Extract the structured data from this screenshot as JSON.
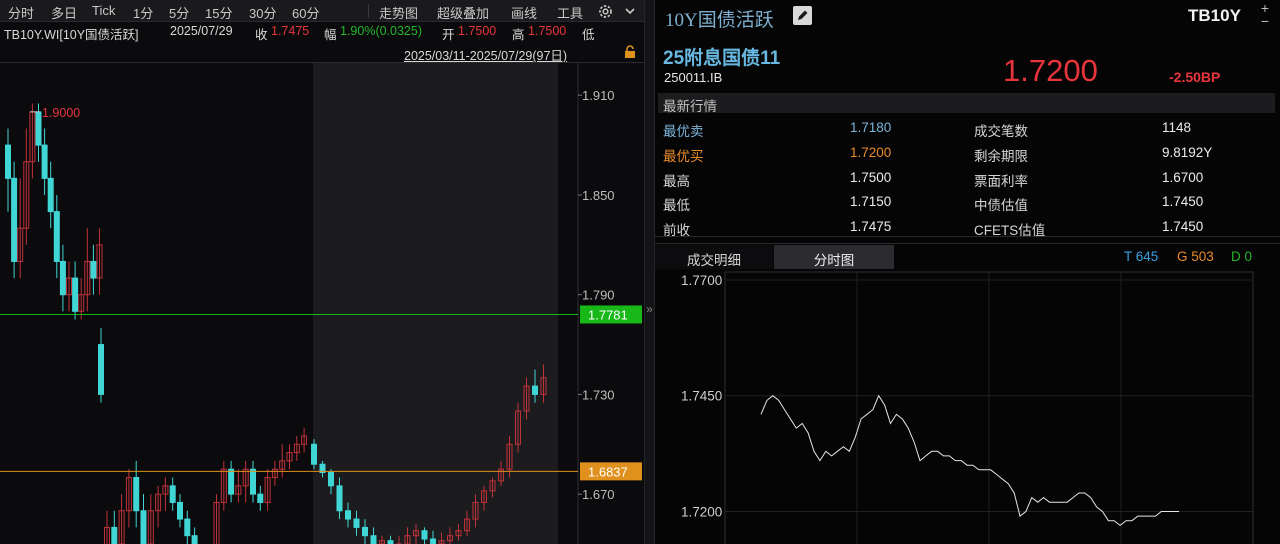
{
  "toolbar": {
    "left_items": [
      "分时",
      "多日",
      "Tick",
      "1分",
      "5分",
      "15分",
      "30分",
      "60分"
    ],
    "right_items": [
      "走势图",
      "超级叠加",
      "画线",
      "工具"
    ],
    "gear_icon": "gear-icon",
    "chevron_icon": "chevron-down-icon"
  },
  "info": {
    "code": "TB10Y.WI[10Y国债活跃]",
    "date": "2025/07/29",
    "close_label": "收",
    "close_value": "1.7475",
    "change_label": "幅",
    "change_value": "1.90%(0.0325)",
    "open_label": "开",
    "open_value": "1.7500",
    "high_label": "高",
    "high_value": "1.7500",
    "low_label": "低",
    "range": "2025/03/11-2025/07/29(97日)",
    "lock_icon": "lock-icon"
  },
  "kline": {
    "max_label": "1.9000",
    "y_ticks": [
      "1.910",
      "1.850",
      "1.790",
      "1.730",
      "1.670"
    ],
    "y_values": [
      1.91,
      1.85,
      1.79,
      1.73,
      1.67
    ],
    "green_line_label": "1.7781",
    "green_line_value": 1.7781,
    "orange_line_label": "1.6837",
    "orange_line_value": 1.6837,
    "up_color": "#c0323a",
    "down_color": "#40d6d6",
    "green_color": "#17b817",
    "orange_color": "#e0901c"
  },
  "chart_data": [
    {
      "type": "candlestick",
      "title": "TB10Y.WI[10Y国债活跃]",
      "ylim": [
        1.64,
        1.93
      ],
      "y_ticks": [
        1.91,
        1.85,
        1.79,
        1.73,
        1.67
      ],
      "series": [
        {
          "name": "K",
          "values": [
            [
              1.88,
              1.86,
              1.89,
              1.84
            ],
            [
              1.86,
              1.81,
              1.87,
              1.8
            ],
            [
              1.81,
              1.83,
              1.86,
              1.8
            ],
            [
              1.83,
              1.87,
              1.89,
              1.82
            ],
            [
              1.87,
              1.9,
              1.905,
              1.86
            ],
            [
              1.9,
              1.88,
              1.905,
              1.87
            ],
            [
              1.88,
              1.86,
              1.89,
              1.85
            ],
            [
              1.86,
              1.84,
              1.87,
              1.83
            ],
            [
              1.84,
              1.81,
              1.85,
              1.8
            ],
            [
              1.81,
              1.79,
              1.82,
              1.78
            ],
            [
              1.79,
              1.8,
              1.81,
              1.78
            ],
            [
              1.8,
              1.78,
              1.81,
              1.775
            ],
            [
              1.78,
              1.79,
              1.8,
              1.775
            ],
            [
              1.79,
              1.81,
              1.83,
              1.78
            ],
            [
              1.81,
              1.8,
              1.82,
              1.79
            ],
            [
              1.8,
              1.82,
              1.83,
              1.79
            ],
            [
              1.76,
              1.73,
              1.77,
              1.725
            ],
            [
              1.63,
              1.65,
              1.66,
              1.62
            ],
            [
              1.65,
              1.64,
              1.66,
              1.63
            ],
            [
              1.64,
              1.66,
              1.67,
              1.63
            ],
            [
              1.66,
              1.68,
              1.685,
              1.65
            ],
            [
              1.68,
              1.66,
              1.69,
              1.65
            ],
            [
              1.66,
              1.64,
              1.67,
              1.63
            ],
            [
              1.64,
              1.66,
              1.67,
              1.63
            ],
            [
              1.66,
              1.67,
              1.675,
              1.65
            ],
            [
              1.67,
              1.675,
              1.68,
              1.66
            ],
            [
              1.675,
              1.665,
              1.68,
              1.66
            ],
            [
              1.665,
              1.655,
              1.67,
              1.65
            ],
            [
              1.655,
              1.645,
              1.66,
              1.64
            ],
            [
              1.645,
              1.635,
              1.65,
              1.63
            ],
            [
              1.635,
              1.625,
              1.64,
              1.62
            ],
            [
              1.625,
              1.635,
              1.64,
              1.62
            ],
            [
              1.635,
              1.665,
              1.67,
              1.63
            ],
            [
              1.665,
              1.685,
              1.69,
              1.66
            ],
            [
              1.685,
              1.67,
              1.69,
              1.665
            ],
            [
              1.67,
              1.675,
              1.685,
              1.665
            ],
            [
              1.675,
              1.685,
              1.69,
              1.665
            ],
            [
              1.685,
              1.67,
              1.69,
              1.665
            ],
            [
              1.67,
              1.665,
              1.675,
              1.66
            ],
            [
              1.665,
              1.68,
              1.685,
              1.66
            ],
            [
              1.68,
              1.685,
              1.69,
              1.675
            ],
            [
              1.685,
              1.69,
              1.7,
              1.68
            ],
            [
              1.69,
              1.695,
              1.7,
              1.685
            ],
            [
              1.695,
              1.7,
              1.705,
              1.69
            ],
            [
              1.7,
              1.705,
              1.71,
              1.695
            ],
            [
              1.7,
              1.688,
              1.703,
              1.685
            ],
            [
              1.688,
              1.683,
              1.69,
              1.68
            ],
            [
              1.683,
              1.675,
              1.685,
              1.67
            ],
            [
              1.675,
              1.66,
              1.68,
              1.655
            ],
            [
              1.66,
              1.655,
              1.665,
              1.65
            ],
            [
              1.655,
              1.65,
              1.66,
              1.645
            ],
            [
              1.65,
              1.645,
              1.655,
              1.64
            ],
            [
              1.645,
              1.64,
              1.65,
              1.635
            ],
            [
              1.64,
              1.642,
              1.645,
              1.635
            ],
            [
              1.642,
              1.638,
              1.645,
              1.635
            ],
            [
              1.638,
              1.64,
              1.645,
              1.635
            ],
            [
              1.64,
              1.645,
              1.65,
              1.635
            ],
            [
              1.645,
              1.648,
              1.652,
              1.64
            ],
            [
              1.648,
              1.643,
              1.65,
              1.64
            ],
            [
              1.643,
              1.64,
              1.648,
              1.635
            ],
            [
              1.64,
              1.642,
              1.647,
              1.637
            ],
            [
              1.642,
              1.645,
              1.65,
              1.64
            ],
            [
              1.645,
              1.648,
              1.652,
              1.642
            ],
            [
              1.648,
              1.655,
              1.66,
              1.645
            ],
            [
              1.655,
              1.665,
              1.67,
              1.65
            ],
            [
              1.665,
              1.672,
              1.675,
              1.66
            ],
            [
              1.672,
              1.678,
              1.68,
              1.668
            ],
            [
              1.678,
              1.685,
              1.69,
              1.675
            ],
            [
              1.685,
              1.7,
              1.705,
              1.68
            ],
            [
              1.7,
              1.72,
              1.725,
              1.695
            ],
            [
              1.72,
              1.735,
              1.74,
              1.715
            ],
            [
              1.735,
              1.73,
              1.745,
              1.725
            ],
            [
              1.73,
              1.74,
              1.748,
              1.725
            ],
            [
              1.745,
              1.7475,
              1.75,
              1.745
            ]
          ]
        }
      ]
    },
    {
      "type": "line",
      "title": "分时图",
      "ylim": [
        1.716,
        1.77
      ],
      "y_ticks": [
        1.77,
        1.745,
        1.72
      ],
      "series": [
        {
          "name": "分时",
          "values": [
            1.741,
            1.744,
            1.745,
            1.744,
            1.742,
            1.74,
            1.738,
            1.739,
            1.737,
            1.733,
            1.731,
            1.733,
            1.732,
            1.733,
            1.734,
            1.733,
            1.736,
            1.74,
            1.741,
            1.742,
            1.745,
            1.743,
            1.739,
            1.741,
            1.74,
            1.738,
            1.735,
            1.731,
            1.732,
            1.733,
            1.733,
            1.732,
            1.732,
            1.731,
            1.731,
            1.73,
            1.73,
            1.729,
            1.729,
            1.729,
            1.728,
            1.727,
            1.726,
            1.724,
            1.719,
            1.72,
            1.723,
            1.722,
            1.723,
            1.722,
            1.722,
            1.722,
            1.722,
            1.723,
            1.724,
            1.724,
            1.723,
            1.721,
            1.72,
            1.718,
            1.718,
            1.717,
            1.718,
            1.718,
            1.719,
            1.719,
            1.719,
            1.719,
            1.72,
            1.72,
            1.72,
            1.72
          ]
        }
      ]
    }
  ],
  "quote": {
    "title": "10Y国债活跃",
    "edit_icon": "edit-icon",
    "code_short": "TB10Y",
    "plus_icon": "plus-icon",
    "minus_icon": "minus-icon",
    "name": "25附息国债11",
    "bond_code": "250011.IB",
    "last": "1.7200",
    "change_bp": "-2.50BP",
    "section_title": "最新行情",
    "rows": [
      {
        "l1": "最优卖",
        "v1": "1.7180",
        "l2": "成交笔数",
        "v2": "1148"
      },
      {
        "l1": "最优买",
        "v1": "1.7200",
        "l2": "剩余期限",
        "v2": "9.8192Y"
      },
      {
        "l1": "最高",
        "v1": "1.7500",
        "l2": "票面利率",
        "v2": "1.6700"
      },
      {
        "l1": "最低",
        "v1": "1.7150",
        "l2": "中债估值",
        "v2": "1.7450"
      },
      {
        "l1": "前收",
        "v1": "1.7475",
        "l2": "CFETS估值",
        "v2": "1.7450"
      }
    ],
    "tabs": [
      "成交明细",
      "分时图"
    ],
    "t_label": "T 645",
    "g_label": "G 503",
    "d_label": "D 0",
    "intraday_ticks": [
      "1.7700",
      "1.7450",
      "1.7200"
    ],
    "collapse_glyph": "»"
  },
  "colors": {
    "red": "#e8353c",
    "green": "#26b52c",
    "cyan_label": "#7bb4d8",
    "orange_label": "#e98a2a"
  }
}
